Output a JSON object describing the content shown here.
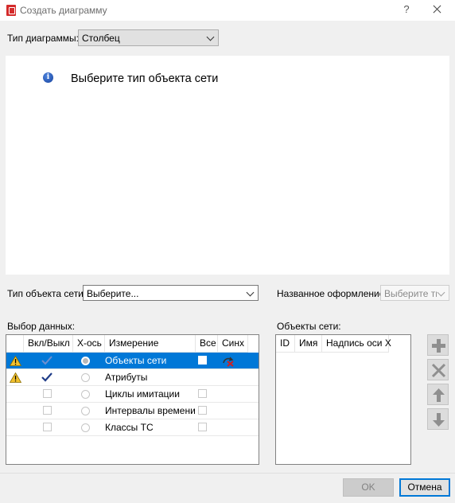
{
  "window": {
    "title": "Создать диаграмму",
    "help_glyph": "?"
  },
  "chart_type": {
    "label": "Тип диаграммы:",
    "value": "Столбец"
  },
  "info": {
    "message": "Выберите тип объекта сети"
  },
  "network_object_type": {
    "label": "Тип объекта сети:",
    "value": "Выберите..."
  },
  "named_style": {
    "label": "Названное оформление:",
    "value": "Выберите тип"
  },
  "data_selection": {
    "label": "Выбор данных:",
    "columns": [
      "Вкл/Выкл",
      "X-ось",
      "Измерение",
      "Все",
      "Синх"
    ],
    "rows": [
      {
        "dimension": "Объекты сети",
        "warning": true,
        "enabled": true,
        "x_axis": true,
        "all": false,
        "sync": true,
        "selected": true
      },
      {
        "dimension": "Атрибуты",
        "warning": true,
        "enabled": true,
        "x_axis": false,
        "all": null,
        "sync": false,
        "selected": false
      },
      {
        "dimension": "Циклы имитации",
        "warning": false,
        "enabled": false,
        "x_axis": false,
        "all": false,
        "sync": false,
        "selected": false
      },
      {
        "dimension": "Интервалы времени",
        "warning": false,
        "enabled": false,
        "x_axis": false,
        "all": false,
        "sync": false,
        "selected": false
      },
      {
        "dimension": "Классы ТС",
        "warning": false,
        "enabled": false,
        "x_axis": false,
        "all": false,
        "sync": false,
        "selected": false
      }
    ]
  },
  "network_objects": {
    "label": "Объекты сети:",
    "columns": [
      "ID",
      "Имя",
      "Надпись оси X"
    ]
  },
  "side_buttons": [
    {
      "name": "add",
      "icon": "plus-icon"
    },
    {
      "name": "remove",
      "icon": "x-icon"
    },
    {
      "name": "move-up",
      "icon": "arrow-up-icon"
    },
    {
      "name": "move-down",
      "icon": "arrow-down-icon"
    }
  ],
  "footer": {
    "ok_label": "OK",
    "cancel_label": "Отмена"
  },
  "colors": {
    "selection": "#0078d7",
    "check": "#1f3c88",
    "warning": "#f2c12e",
    "sync_red": "#d22020"
  }
}
